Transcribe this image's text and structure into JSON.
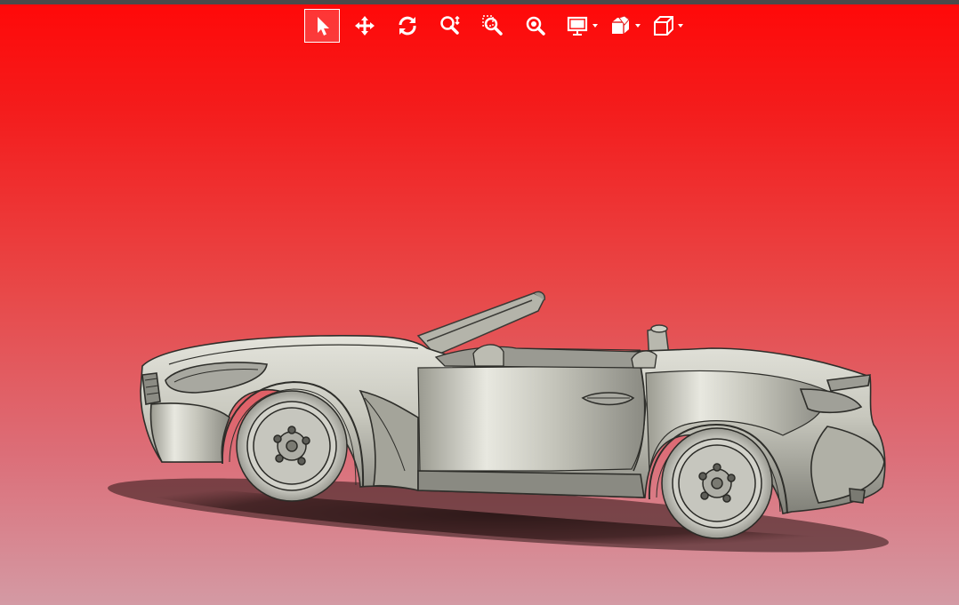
{
  "viewer": {
    "background_top": "#ff0808",
    "background_bottom": "#d49aa4",
    "model_color": "#b8b8ac"
  },
  "toolbar": {
    "tools": [
      {
        "name": "select",
        "icon": "cursor-arrow-icon",
        "active": true,
        "dropdown": false
      },
      {
        "name": "pan",
        "icon": "move-arrows-icon",
        "active": false,
        "dropdown": false
      },
      {
        "name": "rotate",
        "icon": "rotate-icon",
        "active": false,
        "dropdown": false
      },
      {
        "name": "zoom",
        "icon": "zoom-icon",
        "active": false,
        "dropdown": false
      },
      {
        "name": "zoom-window",
        "icon": "zoom-window-icon",
        "active": false,
        "dropdown": false
      },
      {
        "name": "zoom-fit",
        "icon": "zoom-fit-icon",
        "active": false,
        "dropdown": false
      },
      {
        "name": "display",
        "icon": "monitor-icon",
        "active": false,
        "dropdown": true
      },
      {
        "name": "section",
        "icon": "section-cube-icon",
        "active": false,
        "dropdown": true
      },
      {
        "name": "view-orientation",
        "icon": "cube-view-icon",
        "active": false,
        "dropdown": true
      }
    ]
  }
}
